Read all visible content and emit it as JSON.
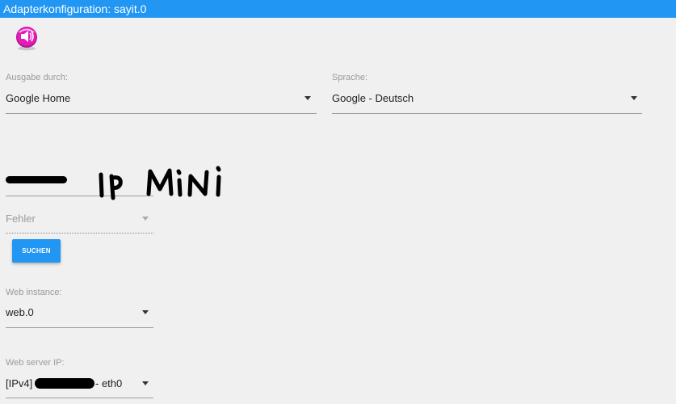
{
  "window": {
    "title": "Adapterkonfiguration: sayit.0"
  },
  "logo": {
    "icon": "sayit-speaker-icon",
    "color": "#e21bb9"
  },
  "output": {
    "label": "Ausgabe durch:",
    "value": "Google Home"
  },
  "language": {
    "label": "Sprache:",
    "value": "Google - Deutsch"
  },
  "device": {
    "value": "Fehler"
  },
  "search_button": {
    "label": "SUCHEN"
  },
  "web_instance": {
    "label": "Web instance:",
    "value": "web.0"
  },
  "web_server_ip": {
    "label": "Web server IP:",
    "prefix": "[IPv4]",
    "suffix": "- eth0"
  },
  "annotation": {
    "handwritten": "IP Mini"
  },
  "colors": {
    "accent": "#2196f3",
    "background": "#f0f0f0"
  }
}
